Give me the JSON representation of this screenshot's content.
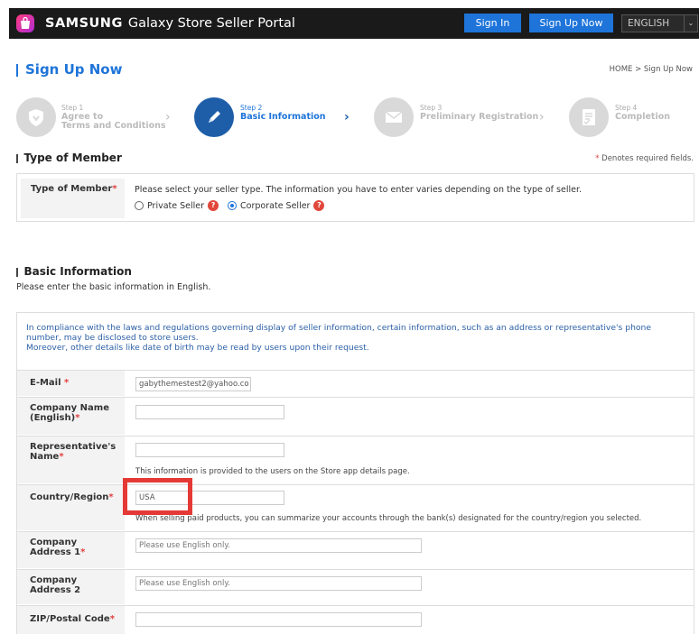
{
  "header": {
    "brand_name": "SAMSUNG",
    "brand_product": "Galaxy Store Seller Portal",
    "sign_in": "Sign In",
    "sign_up": "Sign Up Now",
    "language": "ENGLISH",
    "colors": {
      "bar": "#1a1a1a",
      "accent": "#1e74d9"
    }
  },
  "page": {
    "title": "Sign Up Now",
    "breadcrumb": "HOME > Sign Up Now"
  },
  "steps": [
    {
      "num": "Step 1",
      "name_line1": "Agree to",
      "name_line2": "Terms and Conditions",
      "icon": "shield-icon",
      "active": false
    },
    {
      "num": "Step 2",
      "name_line1": "Basic Information",
      "icon": "pencil-icon",
      "active": true
    },
    {
      "num": "Step 3",
      "name_line1": "Preliminary Registration",
      "icon": "envelope-icon",
      "active": false
    },
    {
      "num": "Step 4",
      "name_line1": "Completion",
      "icon": "document-check-icon",
      "active": false
    }
  ],
  "type_of_member": {
    "section_title": "Type of Member",
    "required_note": "Denotes required fields.",
    "label": "Type of Member",
    "description": "Please select your seller type. The information you have to enter varies depending on the type of seller.",
    "options": [
      "Private Seller",
      "Corporate Seller"
    ],
    "selected": "Corporate Seller"
  },
  "basic_info": {
    "section_title": "Basic Information",
    "subtitle": "Please enter the basic information in English.",
    "notice_line1": "In compliance with the laws and regulations governing display of seller information, certain information, such as an address or representative's phone",
    "notice_line2": "number, may be disclosed to store users.",
    "notice_line3": "Moreover, other details like date of birth may be read by users upon their request.",
    "fields": {
      "email": {
        "label": "E-Mail",
        "value": "gabythemestest2@yahoo.co"
      },
      "company_name": {
        "label_line1": "Company Name",
        "label_line2": "(English)",
        "value": ""
      },
      "representative": {
        "label_line1": "Representative's",
        "label_line2": "Name",
        "value": "",
        "note": "This information is provided to the users on the Store app details page."
      },
      "country": {
        "label": "Country/Region",
        "value": "USA",
        "note": "When selling paid products, you can summarize your accounts through the bank(s) designated for the country/region you selected."
      },
      "address1": {
        "label_line1": "Company",
        "label_line2": "Address 1",
        "placeholder": "Please use English only."
      },
      "address2": {
        "label_line1": "Company",
        "label_line2": "Address 2",
        "placeholder": "Please use English only."
      },
      "zip": {
        "label": "ZIP/Postal Code",
        "value": ""
      }
    }
  },
  "required_mark": "*",
  "help_mark": "?"
}
